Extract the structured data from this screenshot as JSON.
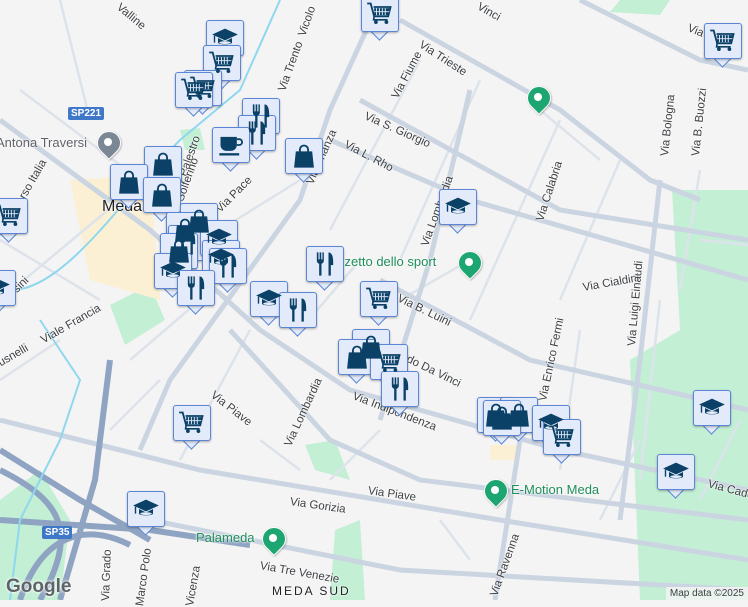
{
  "map": {
    "streets": [
      "Via Milano",
      "Via Trieste",
      "Via Fiume",
      "Via S. Giorgio",
      "Via L. Rho",
      "Via Lombardia",
      "Via Calabria",
      "Via Bologna",
      "Via B. Buozzi",
      "Via Cialdini",
      "Via Luigi Einaudi",
      "Via B. Luini",
      "Leonardo Da Vinci",
      "Via Enrico Fermi",
      "Via Indipendenza",
      "Via Piave",
      "Via Lombardia",
      "Via Piave",
      "Via Gorizia",
      "Via Tre Venezie",
      "Via Ravenna",
      "Via Grado",
      "Marco Polo",
      "Vicenza",
      "Viale Francia",
      "Cusnelli",
      "Via Orsini",
      "Corso Italia",
      "Via Brianza",
      "Via Trento",
      "Vicolo",
      "Via Pace",
      "Palestro",
      "Solferino",
      "Via Cadorna",
      "Vinci",
      "Valline"
    ],
    "places": {
      "town": "Meda",
      "district": "MEDA SUD",
      "church": "Antona Traversi"
    },
    "pois": [
      "Palazzetto dello sport",
      "E-Motion Meda",
      "Palameda"
    ],
    "shields": [
      "SP221",
      "SP35"
    ],
    "colors": {
      "marker_fill": "#e3ebfb",
      "marker_border": "#5b86d6",
      "icon": "#0b4166",
      "poi_green": "#1ea672",
      "park": "#c3efd5"
    }
  },
  "footer": {
    "logo": "Google",
    "attribution": "Map data ©2025"
  }
}
